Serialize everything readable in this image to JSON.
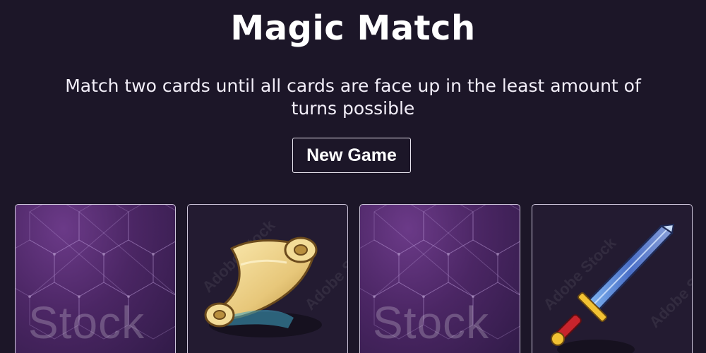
{
  "header": {
    "title": "Magic Match",
    "subtitle": "Match two cards until all cards are face up in the least amount of turns possible"
  },
  "controls": {
    "new_game_label": "New Game"
  },
  "cards": [
    {
      "state": "face-down",
      "back_watermark": "Stock"
    },
    {
      "state": "face-up",
      "icon": "scroll-icon",
      "watermark": "Adobe Stock"
    },
    {
      "state": "face-down",
      "back_watermark": "Stock"
    },
    {
      "state": "face-up",
      "icon": "sword-icon",
      "watermark": "Adobe Stock"
    }
  ],
  "colors": {
    "background": "#1c1628",
    "card_back": "#4b2664",
    "card_face": "#231b31",
    "text": "#ffffff"
  }
}
